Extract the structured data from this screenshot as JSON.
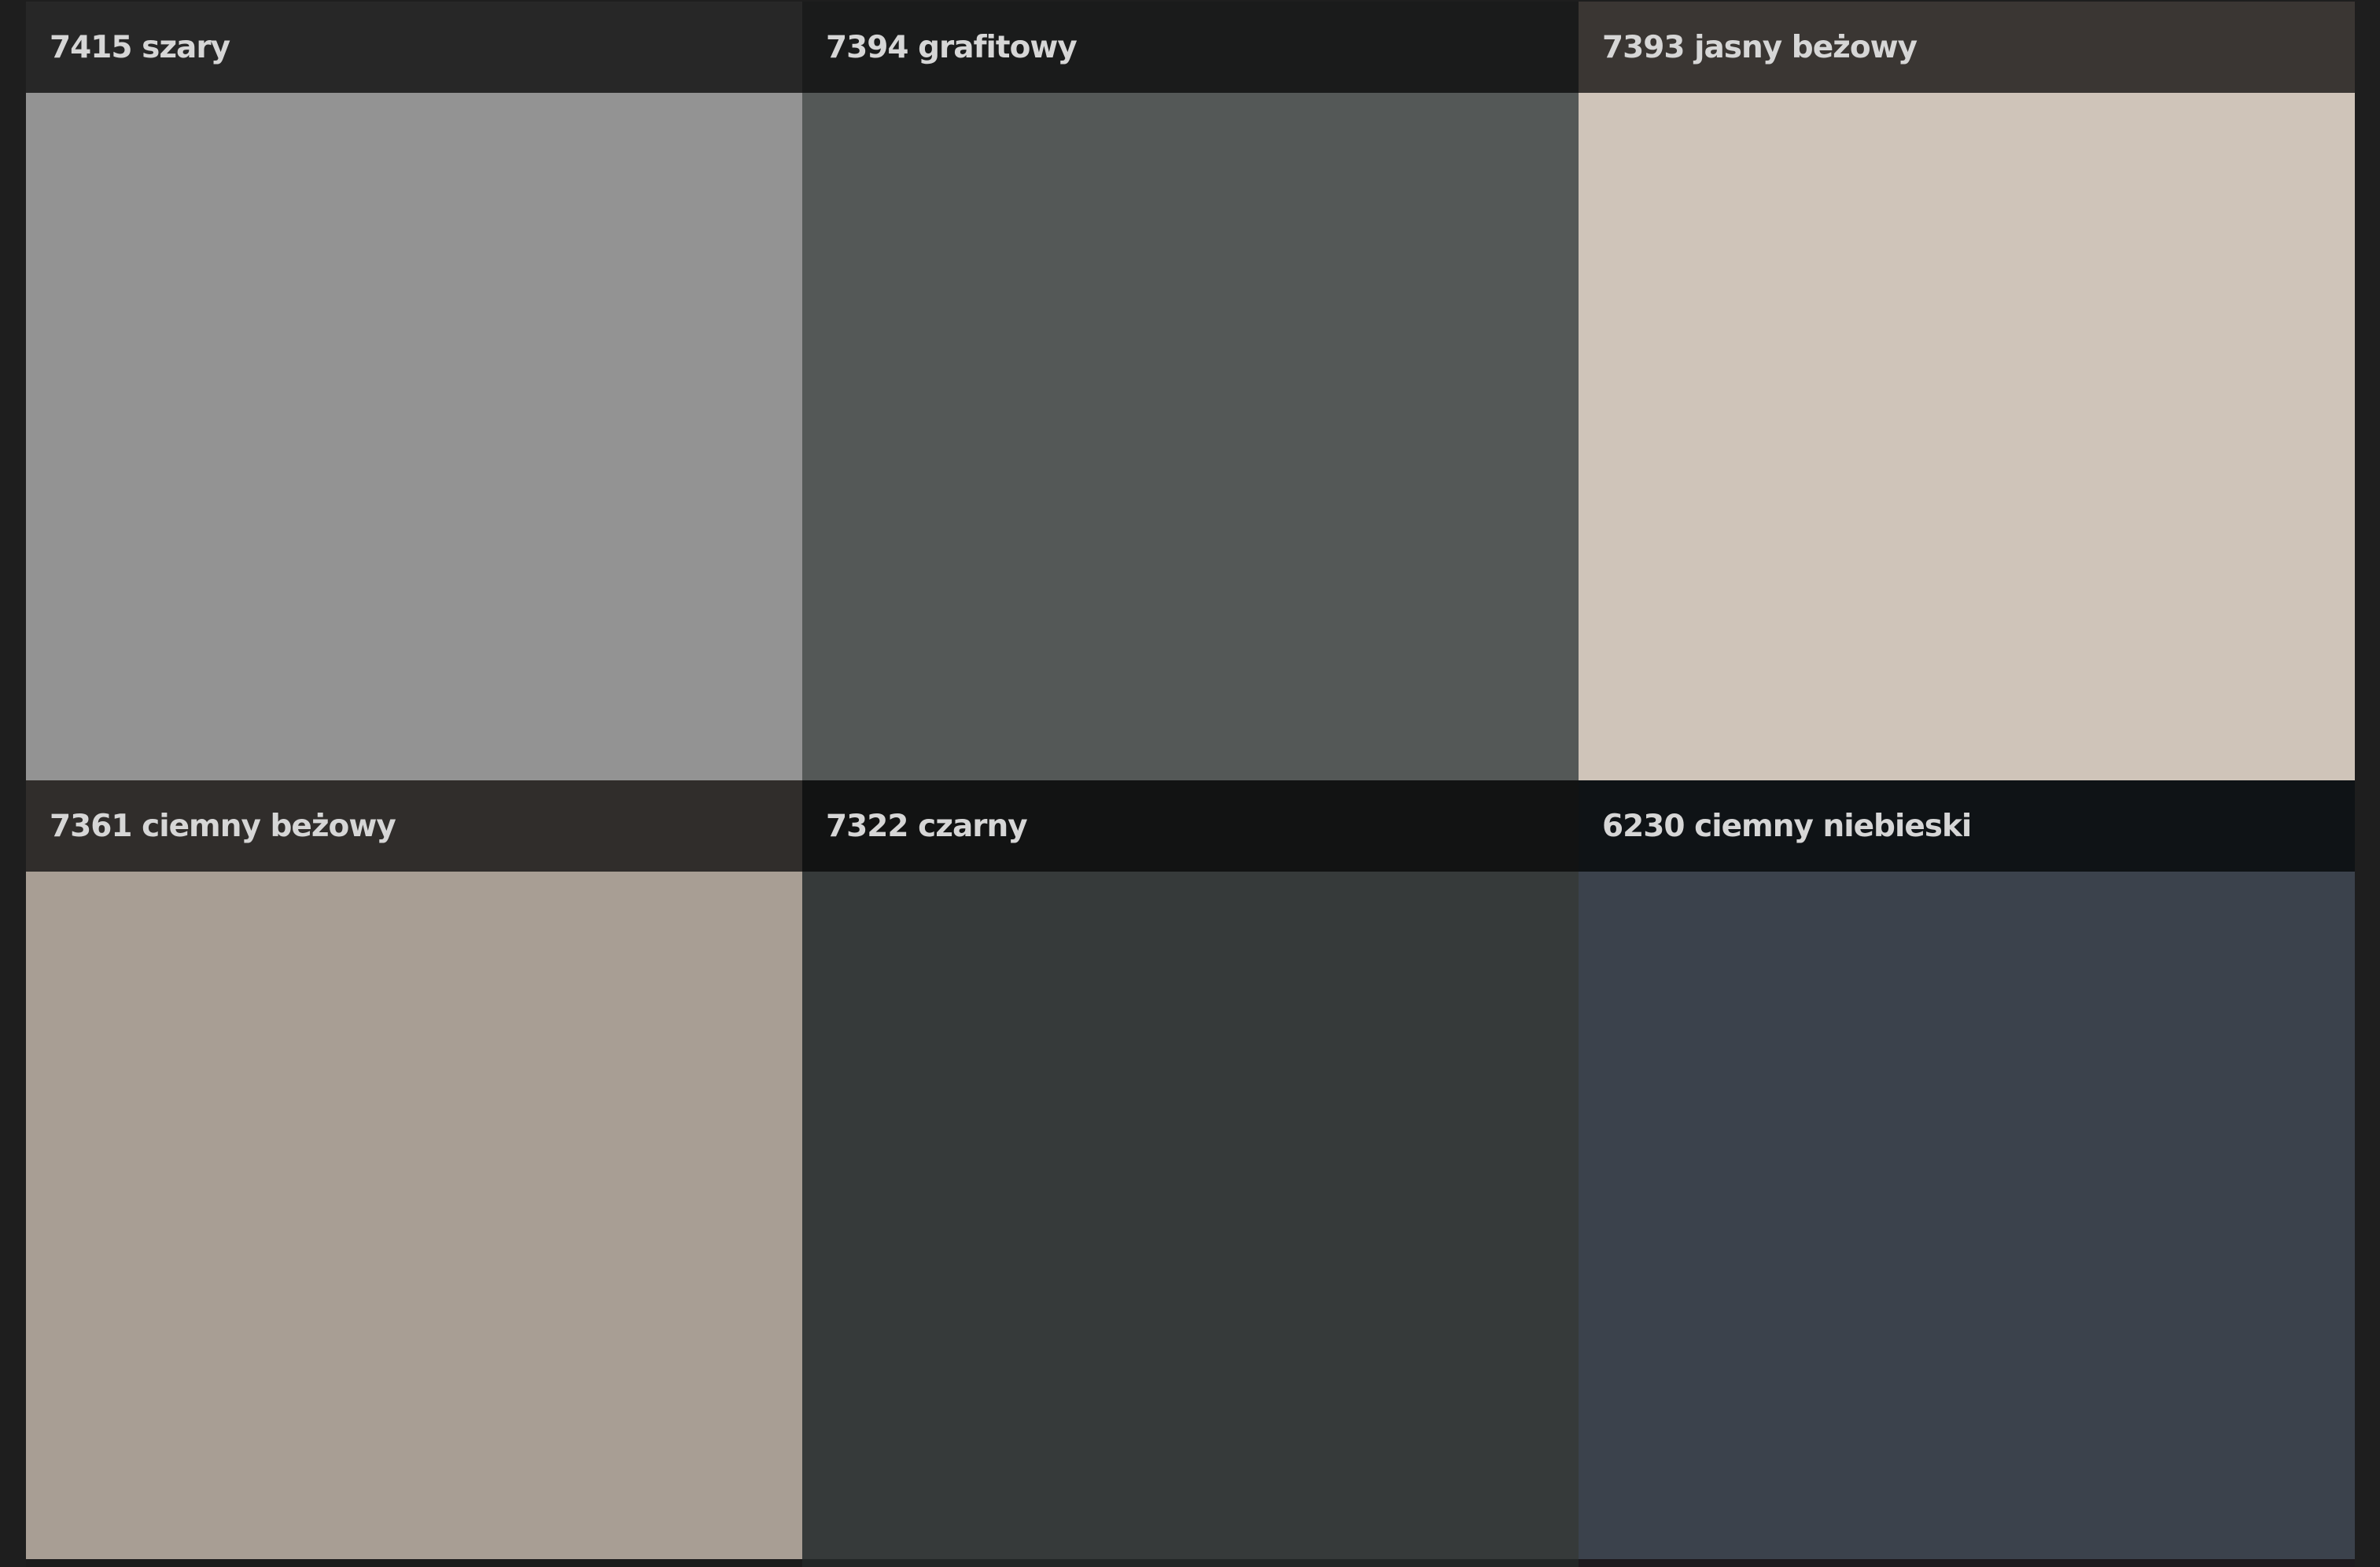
{
  "swatches": [
    {
      "label": "7415 szary",
      "header_color": "#272727",
      "swatch_color": "#939393"
    },
    {
      "label": "7394 grafitowy",
      "header_color": "#1a1b1b",
      "swatch_color": "#545857"
    },
    {
      "label": "7393 jasny beżowy",
      "header_color": "#3a3633",
      "swatch_color": "#cfc4b9"
    },
    {
      "label": "7361 ciemny beżowy",
      "header_color": "#302d2b",
      "swatch_color": "#a89e94"
    },
    {
      "label": "7322 czarny",
      "header_color": "#121313",
      "swatch_color": "#363a3a"
    },
    {
      "label": "6230 ciemny niebieski",
      "header_color": "#0f1316",
      "swatch_color": "#3b424c"
    }
  ],
  "next_row_colors": [
    "#1c1c1c",
    "#222626",
    "#1d1a1e"
  ]
}
